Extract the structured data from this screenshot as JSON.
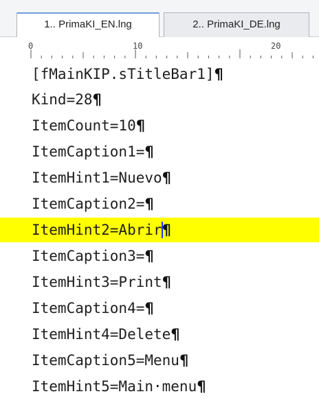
{
  "tabs": [
    {
      "label": "1.. PrimaKI_EN.lng",
      "active": true
    },
    {
      "label": "2.. PrimaKI_DE.lng",
      "active": false
    }
  ],
  "ruler": {
    "numbers": [
      "0",
      "10",
      "20"
    ]
  },
  "lines": [
    {
      "text": "[fMainKIP.sTitleBar1]",
      "eol": "¶"
    },
    {
      "text": "Kind=28",
      "eol": "¶"
    },
    {
      "text": "ItemCount=10",
      "eol": "¶"
    },
    {
      "text": "ItemCaption1=",
      "eol": "¶"
    },
    {
      "text": "ItemHint1=Nuevo",
      "eol": "¶"
    },
    {
      "text": "ItemCaption2=",
      "eol": "¶"
    },
    {
      "text_before_caret": "ItemHint2=Abrir",
      "text_after_caret": "",
      "eol": "¶",
      "highlighted": true
    },
    {
      "text": "ItemCaption3=",
      "eol": "¶"
    },
    {
      "text": "ItemHint3=Print",
      "eol": "¶"
    },
    {
      "text": "ItemCaption4=",
      "eol": "¶"
    },
    {
      "text": "ItemHint4=Delete",
      "eol": "¶"
    },
    {
      "text": "ItemCaption5=Menu",
      "eol": "¶"
    },
    {
      "text": "ItemHint5=Main·menu",
      "eol": "¶"
    }
  ],
  "colors": {
    "highlight": "#ffff00",
    "caret": "#1a3aff",
    "active_tab_accent": "#6ea0dc"
  }
}
